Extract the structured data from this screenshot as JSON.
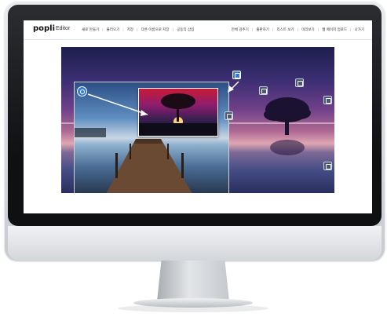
{
  "app": {
    "logo": "popli",
    "logo_sub": "Editor"
  },
  "menu_left": [
    "새로 만들기",
    "불러오기",
    "저장",
    "다른 이름으로 저장",
    "공동작 삽입"
  ],
  "menu_right": [
    "전체 감추기",
    "출판하기",
    "리스트 보기",
    "미리보기",
    "웹 페이지 업로드",
    "나가기"
  ],
  "canvas": {
    "background_colors": [
      "#1d1f4d",
      "#6d3f88",
      "#e0a7b3",
      "#2b2f5e"
    ]
  },
  "icons": [
    {
      "name": "search-icon"
    },
    {
      "name": "image-icon"
    },
    {
      "name": "image-icon"
    },
    {
      "name": "image-icon"
    },
    {
      "name": "image-icon"
    },
    {
      "name": "image-icon"
    },
    {
      "name": "image-icon"
    }
  ]
}
